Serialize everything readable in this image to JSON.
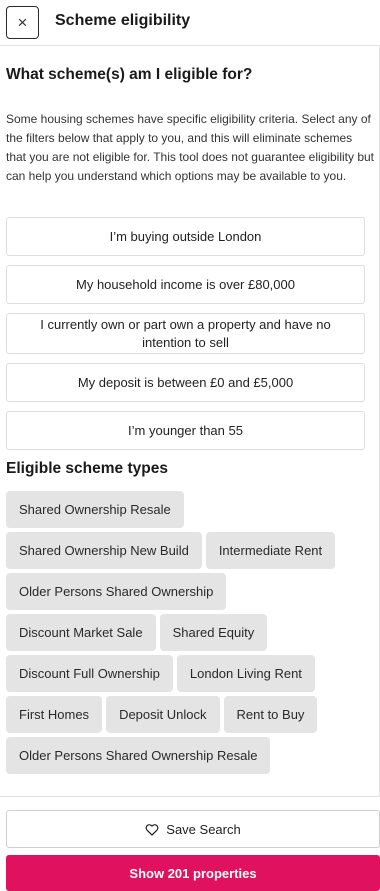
{
  "header": {
    "close_glyph": "×",
    "title": "Scheme eligibility"
  },
  "eligibility": {
    "question": "What scheme(s) am I eligible for?",
    "intro": "Some housing schemes have specific eligibility criteria. Select any of the filters below that apply to you, and this will eliminate schemes that you are not eligible for. This tool does not guarantee eligibility but can help you understand which options may be available to you.",
    "filters": [
      "I’m buying outside London",
      "My household income is over £80,000",
      "I currently own or part own a property and have no intention to sell",
      "My deposit is between £0 and £5,000",
      "I’m younger than 55"
    ]
  },
  "schemes": {
    "title": "Eligible scheme types",
    "chips": [
      "Shared Ownership Resale",
      "Shared Ownership New Build",
      "Intermediate Rent",
      "Older Persons Shared Ownership",
      "Discount Market Sale",
      "Shared Equity",
      "Discount Full Ownership",
      "London Living Rent",
      "First Homes",
      "Deposit Unlock",
      "Rent to Buy",
      "Older Persons Shared Ownership Resale"
    ]
  },
  "footer": {
    "save_label": "Save Search",
    "save_icon": "heart-icon",
    "show_label": "Show 201 properties",
    "accent_color": "#e0115f"
  }
}
